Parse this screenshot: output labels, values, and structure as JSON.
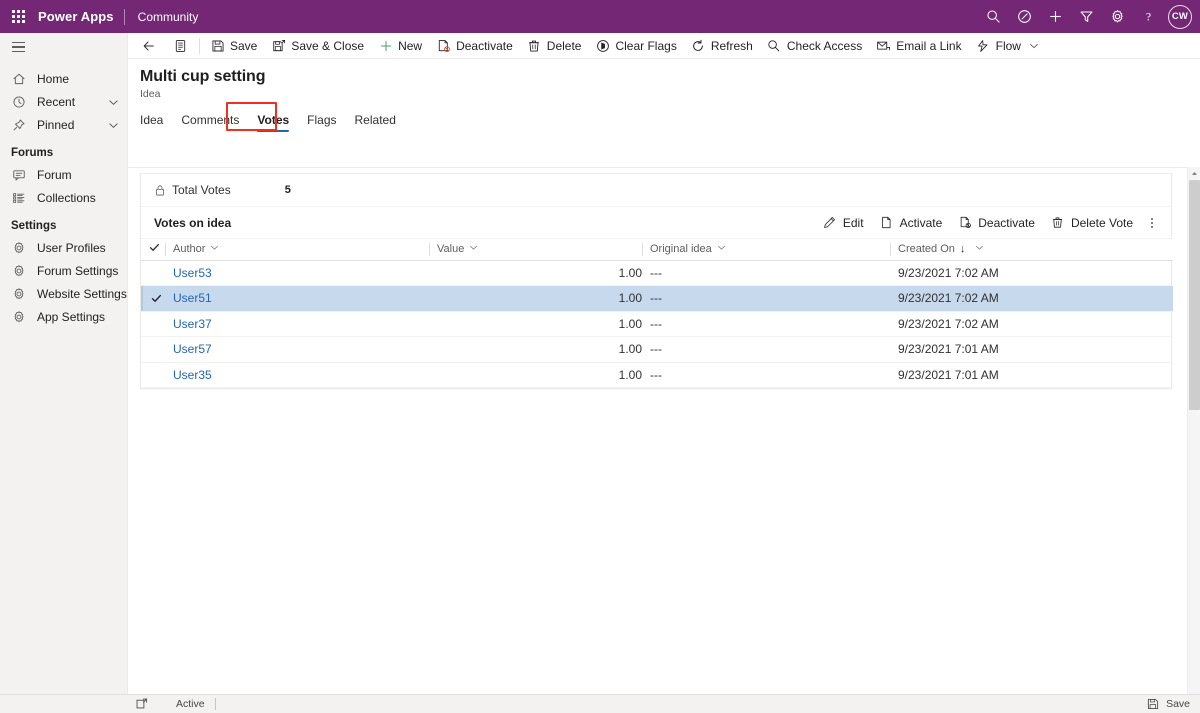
{
  "topbar": {
    "waffle_label": "app-launcher",
    "brand": "Power Apps",
    "environment": "Community",
    "icons": [
      {
        "name": "search-icon",
        "label": "Search"
      },
      {
        "name": "magic-wand-icon",
        "label": "Assistant"
      },
      {
        "name": "plus-icon",
        "label": "New"
      },
      {
        "name": "filter-icon",
        "label": "Filter"
      },
      {
        "name": "gear-icon",
        "label": "Settings"
      },
      {
        "name": "help-icon",
        "label": "Help"
      }
    ],
    "avatar_initials": "CW"
  },
  "sidebar": {
    "hamburger_label": "Site map",
    "items": [
      {
        "label": "Home",
        "icon": "home-icon",
        "chevron": false
      },
      {
        "label": "Recent",
        "icon": "clock-icon",
        "chevron": true
      },
      {
        "label": "Pinned",
        "icon": "pin-icon",
        "chevron": true
      }
    ],
    "group_forums": "Forums",
    "forums_items": [
      {
        "label": "Forum",
        "icon": "forum-icon"
      },
      {
        "label": "Collections",
        "icon": "collections-icon"
      }
    ],
    "group_settings": "Settings",
    "settings_items": [
      {
        "label": "User Profiles",
        "icon": "gear-icon"
      },
      {
        "label": "Forum Settings",
        "icon": "gear-icon"
      },
      {
        "label": "Website Settings",
        "icon": "gear-icon"
      },
      {
        "label": "App Settings",
        "icon": "gear-icon"
      }
    ]
  },
  "commandbar": {
    "back_label": "Back",
    "form_selector_label": "Form selector",
    "buttons": [
      {
        "label": "Save",
        "icon": "save-icon"
      },
      {
        "label": "Save & Close",
        "icon": "save-close-icon"
      },
      {
        "label": "New",
        "icon": "plus-icon"
      },
      {
        "label": "Deactivate",
        "icon": "deactivate-icon"
      },
      {
        "label": "Delete",
        "icon": "trash-icon"
      },
      {
        "label": "Clear Flags",
        "icon": "clear-flags-icon"
      },
      {
        "label": "Refresh",
        "icon": "refresh-icon"
      },
      {
        "label": "Check Access",
        "icon": "check-access-icon"
      },
      {
        "label": "Email a Link",
        "icon": "email-link-icon"
      },
      {
        "label": "Flow",
        "icon": "flow-icon",
        "chevron": true
      }
    ]
  },
  "page": {
    "title": "Multi cup setting",
    "subtitle": "Idea",
    "tabs": [
      {
        "label": "Idea",
        "active": false
      },
      {
        "label": "Comments",
        "active": false
      },
      {
        "label": "Votes",
        "active": true,
        "highlighted": true
      },
      {
        "label": "Flags",
        "active": false
      },
      {
        "label": "Related",
        "active": false
      }
    ],
    "highlight_color": "#f03020",
    "accent_color": "#2266bb"
  },
  "total_votes": {
    "label": "Total Votes",
    "value": "5",
    "lock_icon": "lock-icon"
  },
  "grid": {
    "title": "Votes on idea",
    "commands": [
      {
        "label": "Edit",
        "icon": "pencil-icon"
      },
      {
        "label": "Activate",
        "icon": "activate-icon"
      },
      {
        "label": "Deactivate",
        "icon": "deactivate-icon"
      },
      {
        "label": "Delete Vote",
        "icon": "trash-icon"
      }
    ],
    "overflow_label": "More commands",
    "columns": [
      {
        "label": "Author",
        "sorted": false
      },
      {
        "label": "Value",
        "sorted": false
      },
      {
        "label": "Original idea",
        "sorted": false
      },
      {
        "label": "Created On",
        "sorted": true,
        "sort_dir": "↓"
      }
    ],
    "rows": [
      {
        "author": "User53",
        "value": "1.00",
        "original_idea": "---",
        "created_on": "9/23/2021 7:02 AM",
        "selected": false
      },
      {
        "author": "User51",
        "value": "1.00",
        "original_idea": "---",
        "created_on": "9/23/2021 7:02 AM",
        "selected": true
      },
      {
        "author": "User37",
        "value": "1.00",
        "original_idea": "---",
        "created_on": "9/23/2021 7:02 AM",
        "selected": false
      },
      {
        "author": "User57",
        "value": "1.00",
        "original_idea": "---",
        "created_on": "9/23/2021 7:01 AM",
        "selected": false
      },
      {
        "author": "User35",
        "value": "1.00",
        "original_idea": "---",
        "created_on": "9/23/2021 7:01 AM",
        "selected": false
      }
    ]
  },
  "statusbar": {
    "record_icon": "record-state-icon",
    "status": "Active",
    "save_label": "Save",
    "save_icon": "save-icon"
  }
}
